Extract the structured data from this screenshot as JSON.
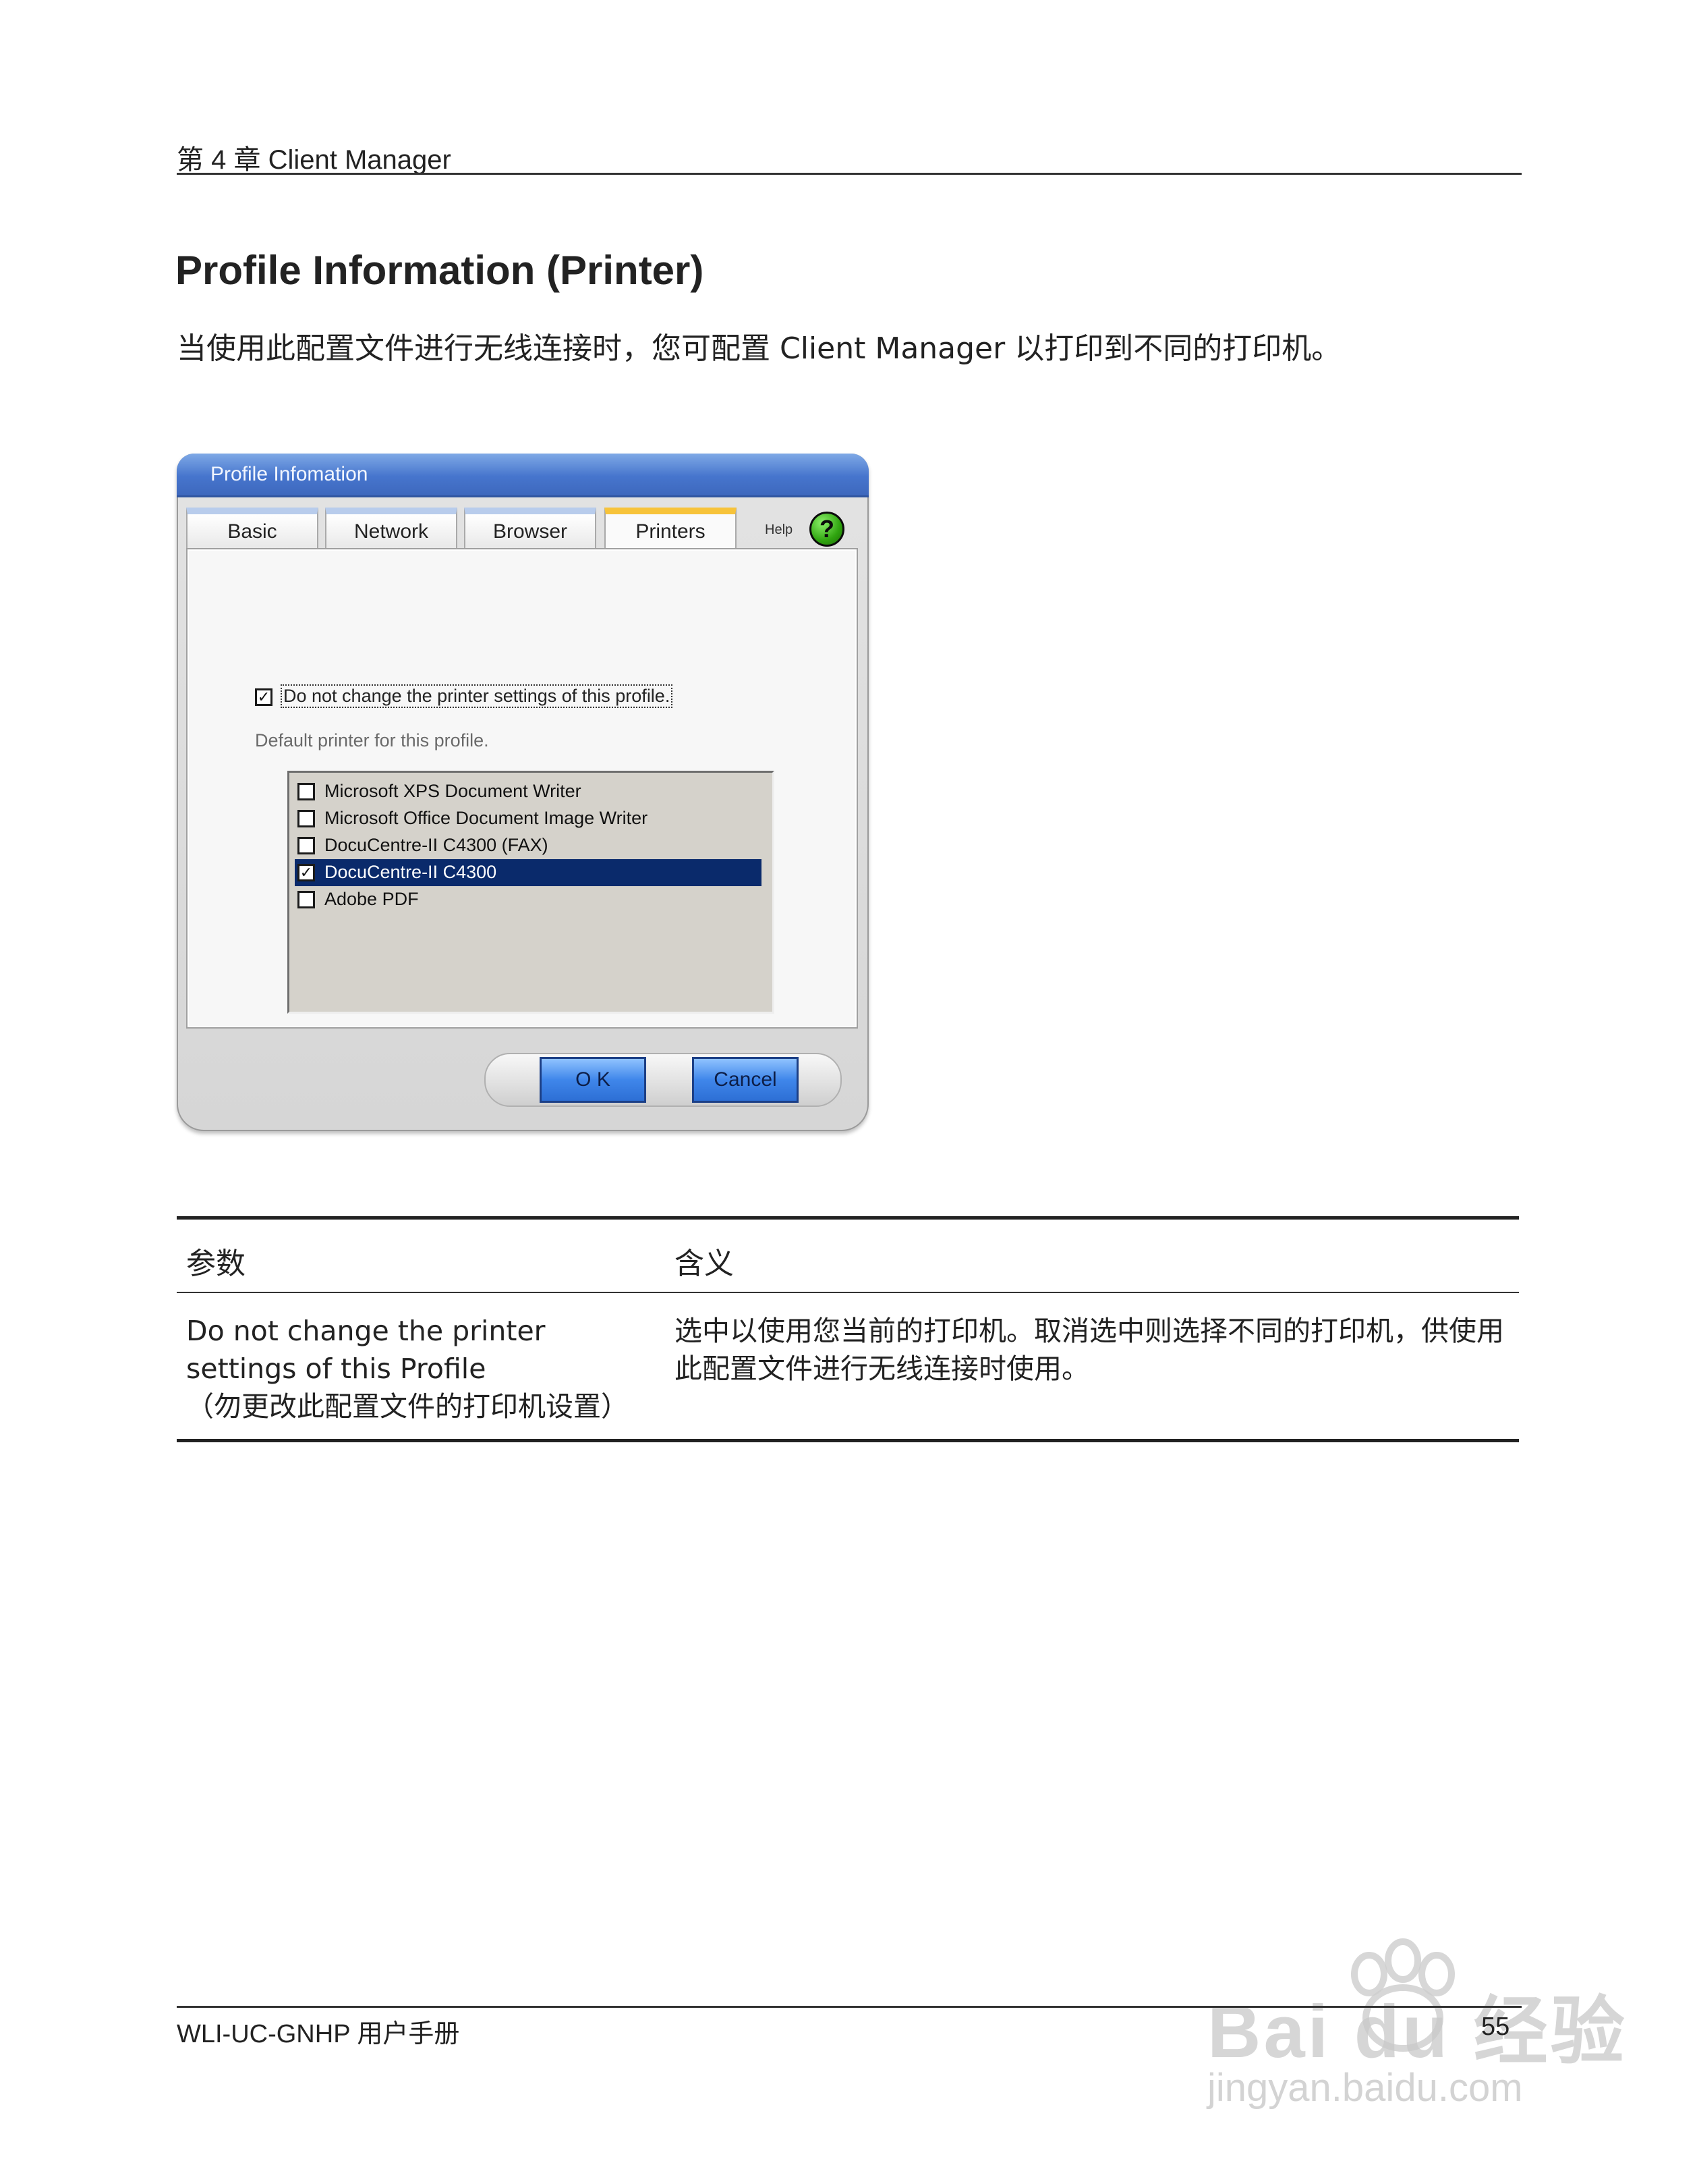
{
  "header": {
    "chapter": "第 4 章 Client Manager"
  },
  "section": {
    "title": "Profile Information (Printer)",
    "intro": "当使用此配置文件进行无线连接时，您可配置 Client Manager 以打印到不同的打印机。"
  },
  "dialog": {
    "title": "Profile Infomation",
    "tabs": [
      "Basic",
      "Network",
      "Browser",
      "Printers"
    ],
    "active_tab": "Printers",
    "help_label": "Help",
    "help_glyph": "?",
    "main_checkbox": {
      "label": "Do not change the printer settings of this profile.",
      "checked": true
    },
    "default_label": "Default printer for this profile.",
    "printers": [
      {
        "name": "Microsoft XPS Document Writer",
        "checked": false,
        "selected": false
      },
      {
        "name": "Microsoft Office Document Image Writer",
        "checked": false,
        "selected": false
      },
      {
        "name": "DocuCentre-II C4300 (FAX)",
        "checked": false,
        "selected": false
      },
      {
        "name": "DocuCentre-II C4300",
        "checked": true,
        "selected": true
      },
      {
        "name": "Adobe PDF",
        "checked": false,
        "selected": false
      }
    ],
    "ok_label": "O K",
    "cancel_label": "Cancel"
  },
  "table": {
    "headers": [
      "参数",
      "含义"
    ],
    "rows": [
      {
        "param": "Do not change the printer settings of this Profile\n（勿更改此配置文件的打印机设置）",
        "meaning": "选中以使用您当前的打印机。取消选中则选择不同的打印机，供使用此配置文件进行无线连接时使用。"
      }
    ]
  },
  "footer": {
    "manual": "WLI-UC-GNHP 用户手册",
    "page": "55"
  },
  "watermark": {
    "text": "Bai du 经验",
    "url": "jingyan.baidu.com"
  },
  "colors": {
    "titlebar": "#4675cd",
    "active_tab": "#f7c33a",
    "selection": "#0a2a6b",
    "button": "#3f86ea",
    "help": "#2fa40f"
  }
}
